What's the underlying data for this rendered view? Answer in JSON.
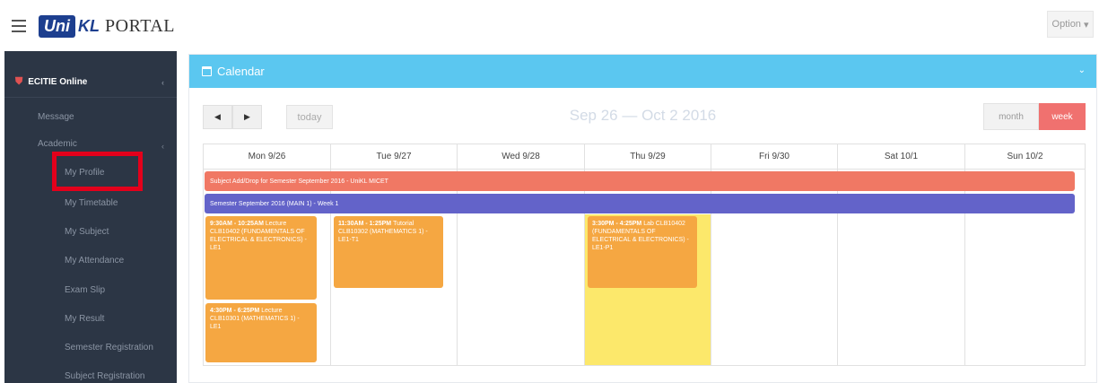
{
  "app": {
    "logo_text": "Uni",
    "logo_suffix": "KL",
    "portal_label": "PORTAL",
    "option_label": "Option",
    "option_caret": "▾"
  },
  "sidebar": {
    "section_title": "ECITIE Online",
    "section_caret": "‹",
    "message_label": "Message",
    "academic_label": "Academic",
    "academic_caret": "‹",
    "items": [
      {
        "label": "My Profile"
      },
      {
        "label": "My Timetable"
      },
      {
        "label": "My Subject"
      },
      {
        "label": "My Attendance"
      },
      {
        "label": "Exam Slip"
      },
      {
        "label": "My Result"
      },
      {
        "label": "Semester Registration"
      },
      {
        "label": "Subject Registration"
      }
    ]
  },
  "calendar": {
    "title": "Calendar",
    "collapse_icon": "⌄",
    "prev_label": "◀",
    "next_label": "▶",
    "today_label": "today",
    "range_label": "Sep 26 — Oct 2 2016",
    "month_label": "month",
    "week_label": "week",
    "days": [
      {
        "label": "Mon 9/26"
      },
      {
        "label": "Tue 9/27"
      },
      {
        "label": "Wed 9/28"
      },
      {
        "label": "Thu 9/29"
      },
      {
        "label": "Fri 9/30"
      },
      {
        "label": "Sat 10/1"
      },
      {
        "label": "Sun 10/2"
      }
    ],
    "allday_events": [
      {
        "text": "Subject Add/Drop for Semester September 2016 - UniKL MICET",
        "color": "#f07864"
      },
      {
        "text": "Semester September 2016 (MAIN 1) - Week 1",
        "color": "#6363c9"
      }
    ],
    "events": [
      {
        "time": "9:30AM - 10:25AM",
        "text": "Lecture CLB10402 (FUNDAMENTALS OF ELECTRICAL & ELECTRONICS) - LE1"
      },
      {
        "time": "4:30PM - 6:25PM",
        "text": "Lecture CLB10301 (MATHEMATICS 1) - LE1"
      },
      {
        "time": "11:30AM - 1:25PM",
        "text": "Tutorial CLB10302 (MATHEMATICS 1) - LE1-T1"
      },
      {
        "time": "3:30PM - 4:25PM",
        "text": "Lab CLB10402 (FUNDAMENTALS OF ELECTRICAL & ELECTRONICS) - LE1-P1"
      }
    ],
    "event_color": "#f5a742",
    "today_highlight_color": "#fce86b"
  }
}
